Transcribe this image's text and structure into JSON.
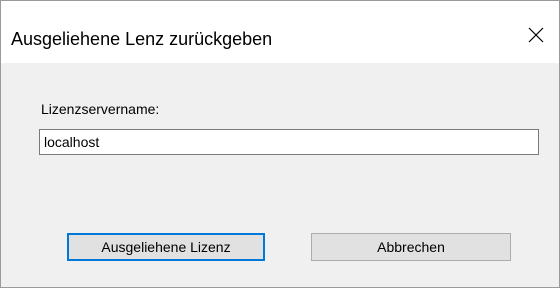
{
  "window": {
    "title": "Ausgeliehene Lenz zurückgeben",
    "close_icon": "close-icon"
  },
  "form": {
    "server_label": "Lizenzservername:",
    "server_value": "localhost"
  },
  "buttons": {
    "primary_label": "Ausgeliehene Lizenz",
    "cancel_label": "Abbrechen"
  },
  "colors": {
    "focus_accent": "#0078d7",
    "button_face": "#e1e1e1",
    "dialog_background": "#f0f0f0"
  }
}
